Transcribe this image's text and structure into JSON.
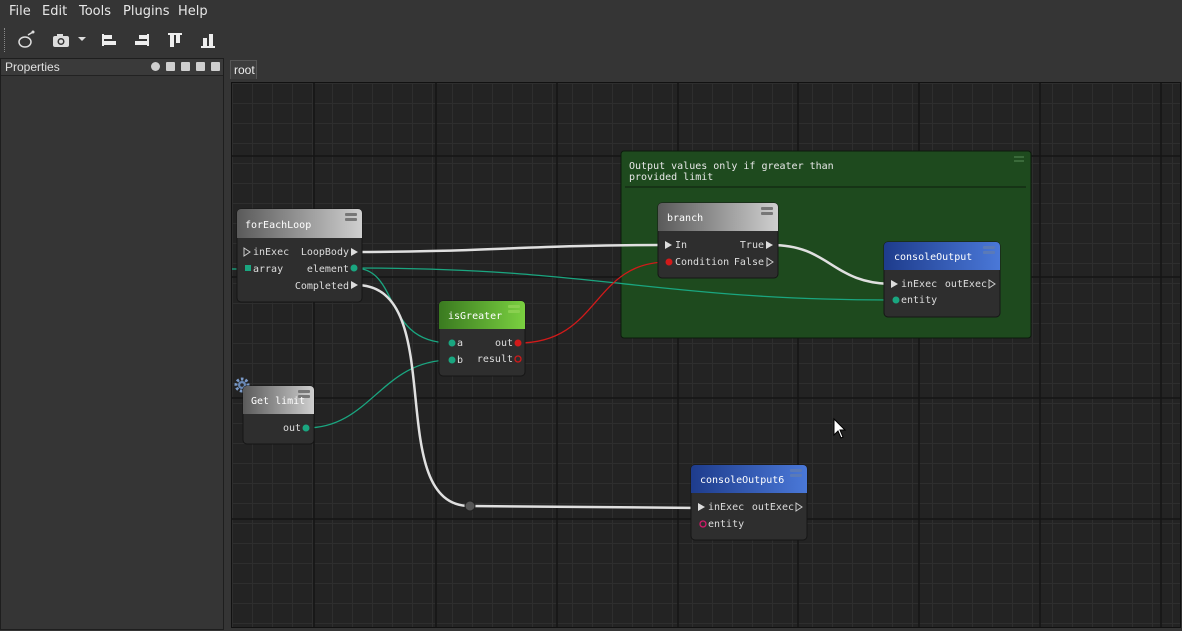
{
  "menu": [
    "File",
    "Edit",
    "Tools",
    "Plugins",
    "Help"
  ],
  "toolbar": {
    "buttons": [
      "bug-icon",
      "camera-icon",
      "dropdown-arrow-icon",
      "align-left-icon",
      "align-right-icon",
      "align-top-icon",
      "align-bottom-icon"
    ]
  },
  "properties_panel": {
    "title": "Properties"
  },
  "tab": {
    "label": "root"
  },
  "group": {
    "text_line1": "Output values only if greater than",
    "text_line2": "provided limit"
  },
  "nodes": {
    "foreach": {
      "title": "forEachLoop",
      "in_exec": "inExec",
      "array": "array",
      "loop_body": "LoopBody",
      "element": "element",
      "completed": "Completed"
    },
    "branch": {
      "title": "branch",
      "in": "In",
      "condition": "Condition",
      "true": "True",
      "false": "False"
    },
    "console_output": {
      "title": "consoleOutput",
      "in_exec": "inExec",
      "entity": "entity",
      "out_exec": "outExec"
    },
    "is_greater": {
      "title": "isGreater",
      "a": "a",
      "b": "b",
      "out": "out",
      "result": "result"
    },
    "get_limit": {
      "title": "Get limit",
      "out": "out"
    },
    "console_output6": {
      "title": "consoleOutput6",
      "in_exec": "inExec",
      "entity": "entity",
      "out_exec": "outExec"
    }
  },
  "colors": {
    "group": "#1e4a1e",
    "header_green": "#5aa02c",
    "header_blue": "#2b56b5",
    "wire_data": "#1aa680",
    "wire_bool": "#d21a1a",
    "wire_exec": "#e0e0e0"
  }
}
